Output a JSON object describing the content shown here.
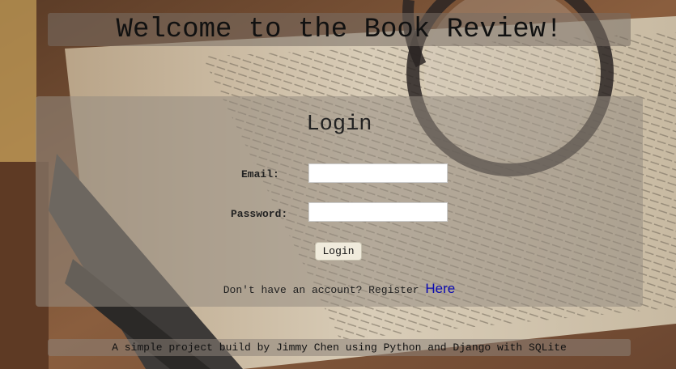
{
  "header": {
    "title": "Welcome to the Book Review!"
  },
  "login": {
    "heading": "Login",
    "email_label": "Email:",
    "email_value": "",
    "password_label": "Password:",
    "password_value": "",
    "button_label": "Login",
    "register_prompt": "Don't have an account? Register ",
    "register_link": "Here"
  },
  "footer": {
    "text": "A simple project build by Jimmy Chen using Python and Django with SQLite"
  }
}
